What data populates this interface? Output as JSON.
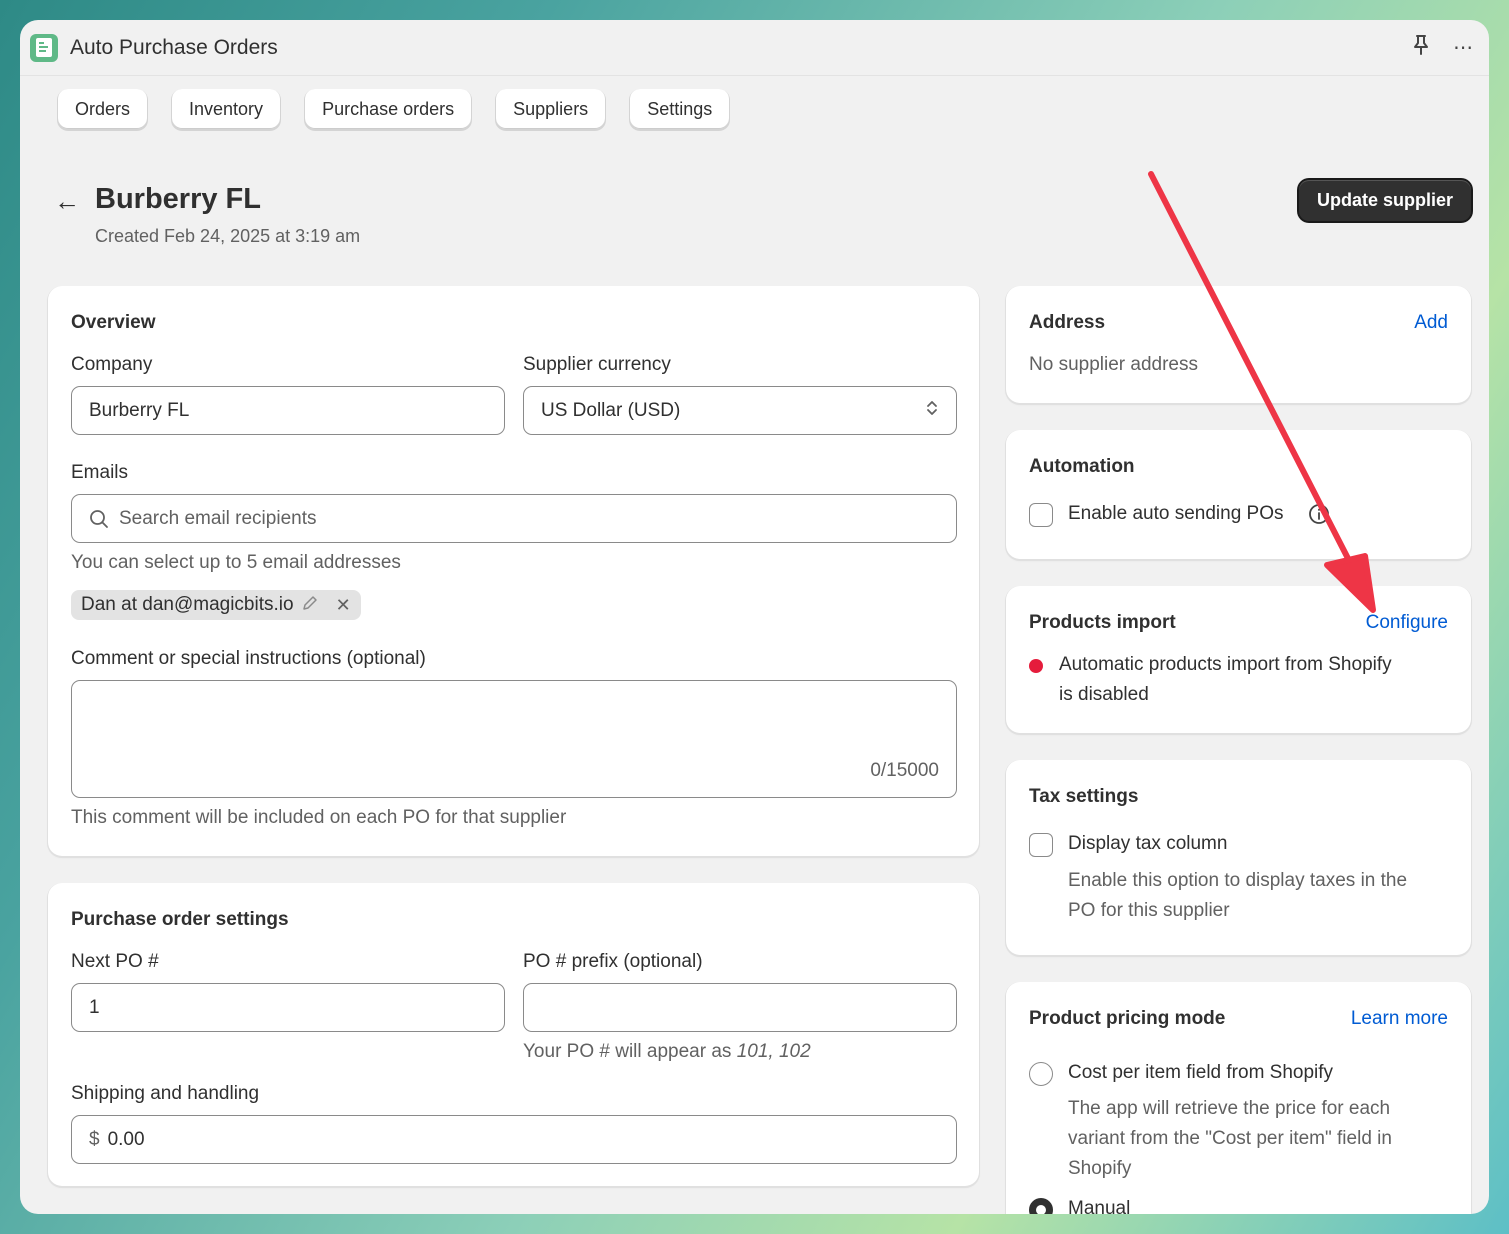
{
  "app": {
    "title": "Auto Purchase Orders",
    "more_icon": "⋯",
    "pin_icon": "⚲"
  },
  "nav": {
    "tabs": [
      "Orders",
      "Inventory",
      "Purchase orders",
      "Suppliers",
      "Settings"
    ]
  },
  "header": {
    "back_icon": "←",
    "title": "Burberry FL",
    "subtitle": "Created Feb 24, 2025 at 3:19 am",
    "primary_button": "Update supplier"
  },
  "overview": {
    "title": "Overview",
    "company_label": "Company",
    "company_value": "Burberry FL",
    "currency_label": "Supplier currency",
    "currency_value": "US Dollar (USD)",
    "emails_label": "Emails",
    "email_search_placeholder": "Search email recipients",
    "email_help": "You can select up to 5 email addresses",
    "email_chip": "Dan at dan@magicbits.io",
    "comment_label": "Comment or special instructions (optional)",
    "comment_counter": "0/15000",
    "comment_help": "This comment will be included on each PO for that supplier"
  },
  "po_settings": {
    "title": "Purchase order settings",
    "next_po_label": "Next PO #",
    "next_po_value": "1",
    "prefix_label": "PO # prefix (optional)",
    "prefix_help_prefix": "Your PO # will appear as ",
    "prefix_help_example": "101, 102",
    "shipping_label": "Shipping and handling",
    "shipping_currency": "$",
    "shipping_value": "0.00"
  },
  "address": {
    "title": "Address",
    "action": "Add",
    "empty_text": "No supplier address"
  },
  "automation": {
    "title": "Automation",
    "checkbox_label": "Enable auto sending POs"
  },
  "products_import": {
    "title": "Products import",
    "action": "Configure",
    "status_line1": "Automatic products import from Shopify",
    "status_line2": "is disabled",
    "status_color": "#e51c3c"
  },
  "tax": {
    "title": "Tax settings",
    "checkbox_label": "Display tax column",
    "help_line1": "Enable this option to display taxes in the",
    "help_line2": "PO for this supplier"
  },
  "pricing": {
    "title": "Product pricing mode",
    "action": "Learn more",
    "option1_label": "Cost per item field from Shopify",
    "option1_help1": "The app will retrieve the price for each",
    "option1_help2": "variant from the \"Cost per item\" field in",
    "option1_help3": "Shopify",
    "option2_label": "Manual"
  },
  "annotation": {
    "arrow_color": "#ee3546"
  }
}
